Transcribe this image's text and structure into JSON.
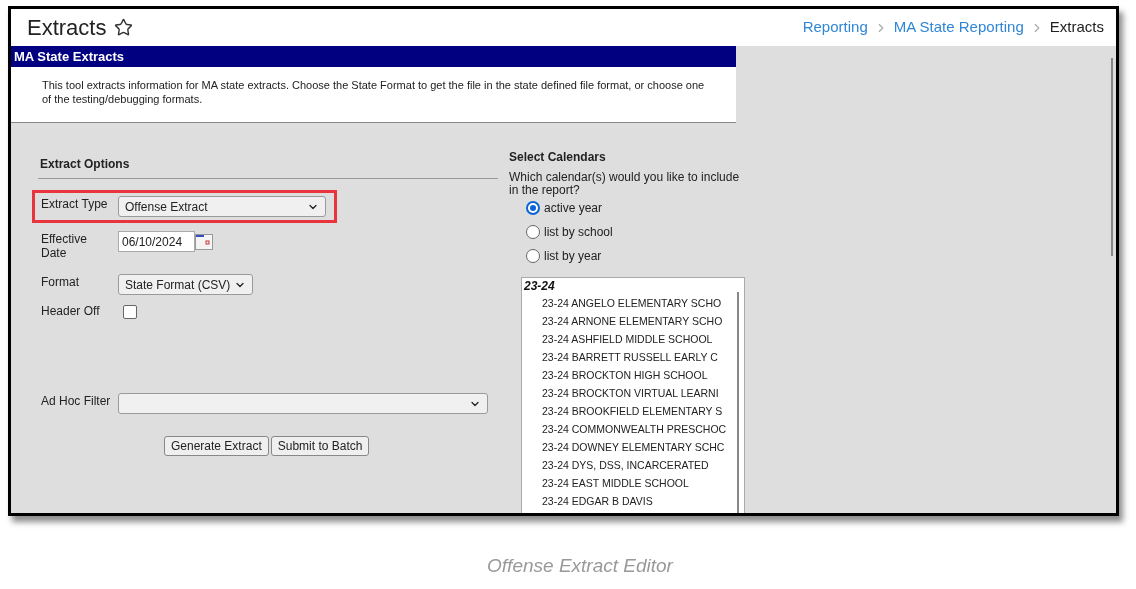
{
  "page": {
    "title": "Extracts",
    "breadcrumbs": [
      {
        "label": "Reporting",
        "current": false
      },
      {
        "label": "MA State Reporting",
        "current": false
      },
      {
        "label": "Extracts",
        "current": true
      }
    ]
  },
  "panel": {
    "title": "MA State Extracts",
    "description": "This tool extracts information for MA state extracts. Choose the State Format to get the file in the state defined file format, or choose one of the testing/debugging formats."
  },
  "extract_options": {
    "heading": "Extract Options",
    "fields": [
      {
        "kind": "select",
        "label": "Extract Type",
        "value": "Offense Extract",
        "highlighted": true
      },
      {
        "kind": "date",
        "label": "Effective Date",
        "value": "06/10/2024",
        "highlighted": false
      },
      {
        "kind": "select-small",
        "label": "Format",
        "value": "State Format (CSV)",
        "highlighted": false
      },
      {
        "kind": "checkbox",
        "label": "Header Off",
        "checked": false,
        "highlighted": false
      },
      {
        "kind": "select-wide",
        "label": "Ad Hoc Filter",
        "highlighted": false
      }
    ],
    "buttons": [
      "Generate Extract",
      "Submit to Batch"
    ]
  },
  "calendars": {
    "heading": "Select Calendars",
    "question": "Which calendar(s) would you like to include in the report?",
    "options": [
      {
        "label": "active year",
        "selected": true
      },
      {
        "label": "list by school",
        "selected": false
      },
      {
        "label": "list by year",
        "selected": false
      }
    ],
    "list": {
      "group": "23-24",
      "items": [
        "23-24 ANGELO ELEMENTARY SCHO",
        "23-24 ARNONE ELEMENTARY SCHO",
        "23-24 ASHFIELD MIDDLE SCHOOL",
        "23-24 BARRETT RUSSELL EARLY C",
        "23-24 BROCKTON HIGH SCHOOL",
        "23-24 BROCKTON VIRTUAL LEARNI",
        "23-24 BROOKFIELD ELEMENTARY S",
        "23-24 COMMONWEALTH PRESCHOC",
        "23-24 DOWNEY ELEMENTARY SCHC",
        "23-24 DYS, DSS, INCARCERATED",
        "23-24 EAST MIDDLE SCHOOL",
        "23-24 EDGAR B DAVIS"
      ]
    }
  },
  "caption": "Offense Extract Editor"
}
